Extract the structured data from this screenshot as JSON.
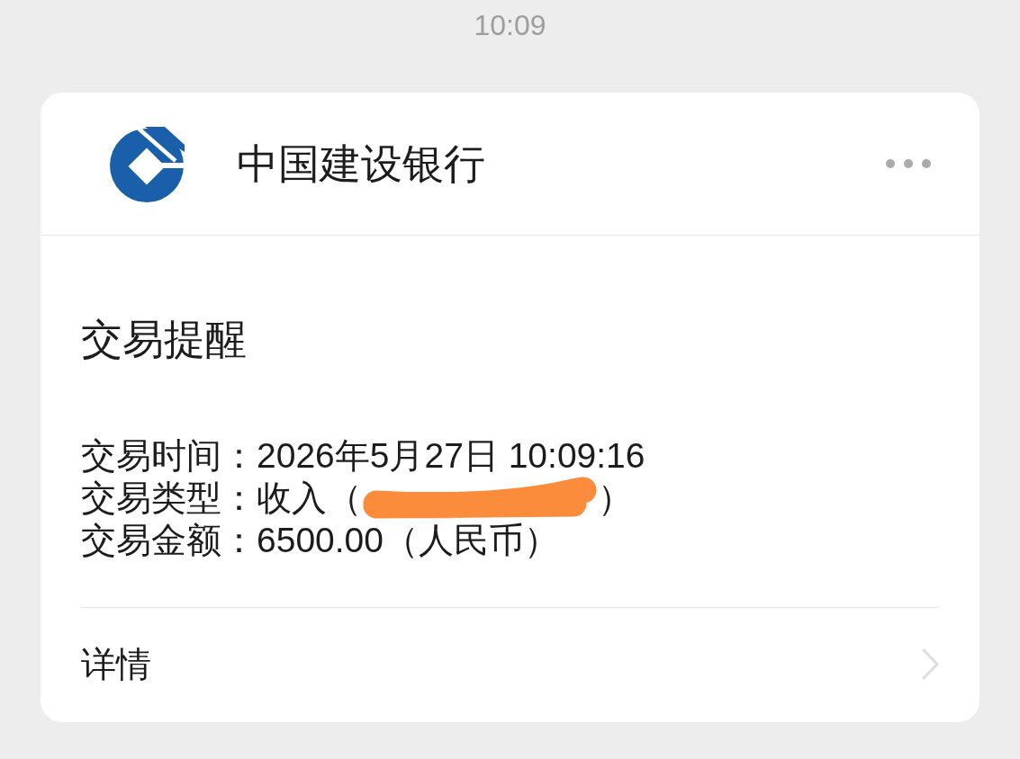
{
  "status_bar": {
    "time": "10:09"
  },
  "notification": {
    "sender": "中国建设银行",
    "title": "交易提醒",
    "fields": [
      {
        "label": "交易时间：",
        "value": "2026年5月27日 10:09:16",
        "redacted": false
      },
      {
        "label": "交易类型：",
        "value": "收入（",
        "redacted": true,
        "value_after": "）"
      },
      {
        "label": "交易金额：",
        "value": "6500.00（人民币）",
        "redacted": false
      }
    ],
    "footer_link": "详情"
  }
}
